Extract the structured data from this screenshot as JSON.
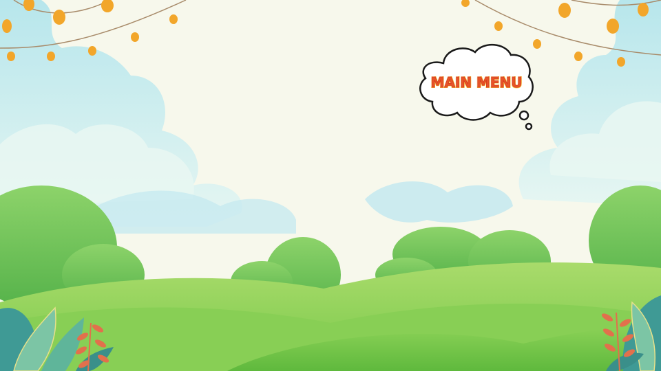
{
  "screen": "title-screen",
  "menu_button": {
    "label": "MAIN MENU",
    "icon": "thought-bubble-icon"
  },
  "colors": {
    "sky": "#f7f8ec",
    "cloud": "#c9ecef",
    "hill_light": "#9fd563",
    "hill_dark": "#6cc243",
    "bush": "#74c75a",
    "light_bulb": "#f2a62a",
    "menu_text": "#e8542a",
    "leaf_red": "#e2704c",
    "leaf_teal": "#4aa6a0"
  },
  "decorations": [
    "string-lights",
    "clouds",
    "hills",
    "bushes",
    "leaves"
  ]
}
